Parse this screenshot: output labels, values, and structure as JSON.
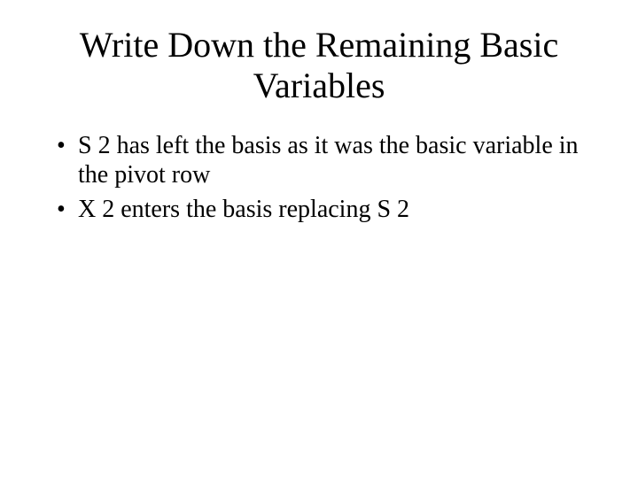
{
  "slide": {
    "title": "Write Down the Remaining Basic Variables",
    "bullets": [
      "S 2 has left the basis as it was the basic variable in the pivot row",
      "X 2 enters the basis replacing S 2"
    ]
  }
}
